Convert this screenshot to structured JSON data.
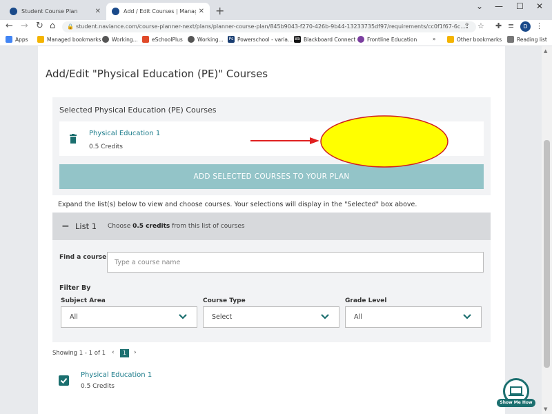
{
  "browser": {
    "tabs": [
      {
        "title": "Student Course Plan",
        "favicon_color": "#1a4a8a"
      },
      {
        "title": "Add / Edit Courses | Manage Co...",
        "favicon_color": "#1a4a8a"
      }
    ],
    "url": "student.naviance.com/course-planner-next/plans/planner-course-plan/845b9043-f270-426b-9b44-13233735df97/requirements/cc0f1f67-6c...",
    "profile_initial": "D",
    "bookmarks": [
      "Apps",
      "Managed bookmarks",
      "Working...",
      "eSchoolPlus",
      "Working...",
      "Powerschool - varia...",
      "Blackboard Connect",
      "Frontline Education",
      "Other bookmarks",
      "Reading list"
    ],
    "bookmark_overflow": "»"
  },
  "page": {
    "title": "Add/Edit \"Physical Education (PE)\" Courses",
    "selected": {
      "heading": "Selected Physical Education (PE) Courses",
      "course_name": "Physical Education 1",
      "course_credits": "0.5 Credits",
      "add_button": "ADD SELECTED COURSES TO YOUR PLAN"
    },
    "instructions": "Expand the list(s) below to view and choose courses. Your selections will display in the \"Selected\" box above.",
    "list": {
      "toggle": "−",
      "title": "List 1",
      "desc_prefix": "Choose",
      "desc_bold": "0.5 credits",
      "desc_suffix": "from this list of courses"
    },
    "find": {
      "label": "Find a course",
      "placeholder": "Type a course name"
    },
    "filter": {
      "label": "Filter By",
      "subject_label": "Subject Area",
      "subject_value": "All",
      "type_label": "Course Type",
      "type_value": "Select",
      "grade_label": "Grade Level",
      "grade_value": "All"
    },
    "pagination": {
      "showing": "Showing 1 - 1 of 1",
      "prev": "‹",
      "current": "1",
      "next": "›"
    },
    "result": {
      "course_name": "Physical Education 1",
      "course_credits": "0.5 Credits"
    },
    "help_button": "Show Me How"
  },
  "colors": {
    "accent": "#1b6f6f",
    "link": "#1b7b8a",
    "add_button_bg": "#93c4c8",
    "annotation_arrow": "#e02020",
    "annotation_oval": "#ffff00"
  }
}
